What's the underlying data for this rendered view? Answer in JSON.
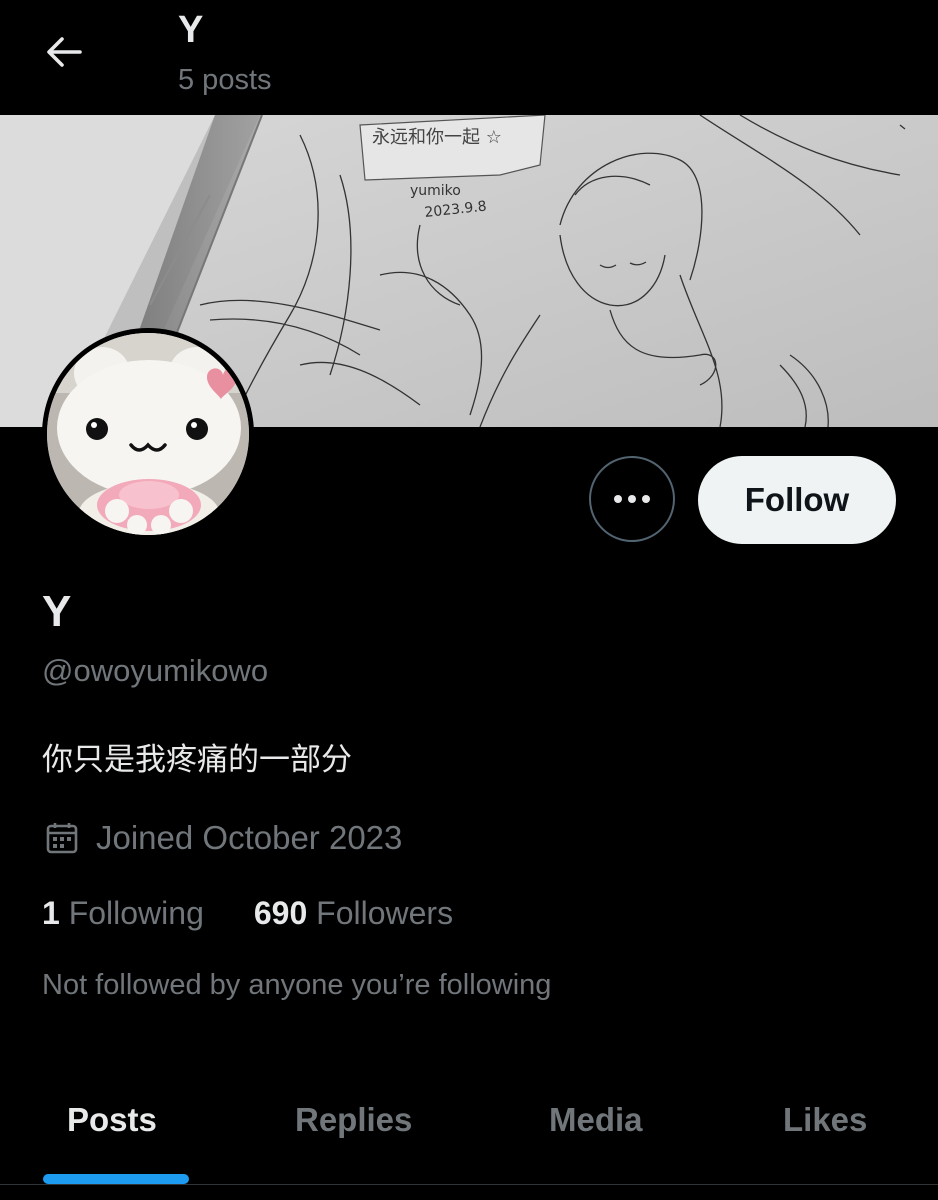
{
  "header": {
    "title": "Y",
    "post_count": "5 posts"
  },
  "banner": {
    "sketch_text_1": "yumiko",
    "sketch_text_2": "2023.9.8",
    "sketch_text_3": "永远和你一起"
  },
  "actions": {
    "follow_label": "Follow",
    "more_icon": "more-dots-icon"
  },
  "profile": {
    "display_name": "Y",
    "handle": "@owoyumikowo",
    "bio": "你只是我疼痛的一部分",
    "joined": "Joined October 2023",
    "following_count": "1",
    "following_label": "Following",
    "followers_count": "690",
    "followers_label": "Followers",
    "not_followed_text": "Not followed by anyone you’re following"
  },
  "tabs": [
    {
      "label": "Posts",
      "active": true
    },
    {
      "label": "Replies",
      "active": false
    },
    {
      "label": "Media",
      "active": false
    },
    {
      "label": "Likes",
      "active": false
    }
  ],
  "colors": {
    "background": "#000000",
    "primary_text": "#e7e9ea",
    "secondary_text": "#71767b",
    "accent": "#1d9bf0",
    "follow_button_bg": "#eff3f4"
  }
}
